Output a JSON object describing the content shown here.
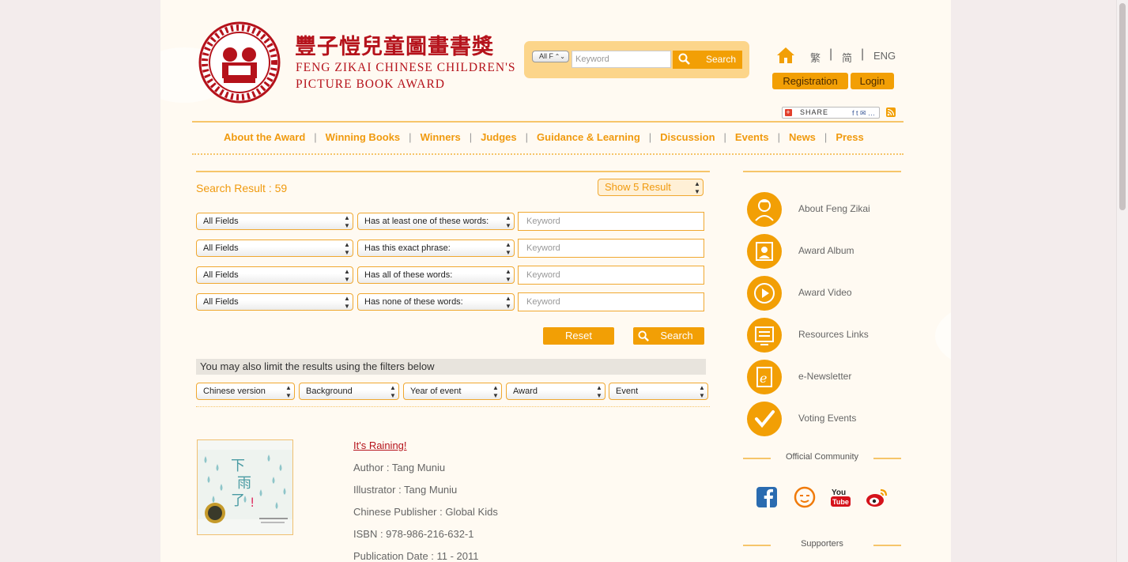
{
  "header": {
    "logo_zh": "豐子愷兒童圖畫書獎",
    "logo_en_line1": "FENG ZIKAI CHINESE CHILDREN'S",
    "logo_en_line2": "PICTURE BOOK AWARD"
  },
  "top_search": {
    "scope": "All F",
    "placeholder": "Keyword",
    "button": "Search"
  },
  "languages": [
    "繁",
    "简",
    "ENG"
  ],
  "account": {
    "register": "Registration",
    "login": "Login"
  },
  "share": {
    "label": "SHARE",
    "icons": "f t ✉ …"
  },
  "nav": [
    "About the Award",
    "Winning Books",
    "Winners",
    "Judges",
    "Guidance & Learning",
    "Discussion",
    "Events",
    "News",
    "Press"
  ],
  "search": {
    "result_label": "Search Result : 59",
    "show_option": "Show 5 Result",
    "rows": [
      {
        "field": "All Fields",
        "mode": "Has at least one of these words:",
        "placeholder": "Keyword"
      },
      {
        "field": "All Fields",
        "mode": "Has this exact phrase:",
        "placeholder": "Keyword"
      },
      {
        "field": "All Fields",
        "mode": "Has all of these words:",
        "placeholder": "Keyword"
      },
      {
        "field": "All Fields",
        "mode": "Has none of these words:",
        "placeholder": "Keyword"
      }
    ],
    "reset": "Reset",
    "search": "Search",
    "limit_text": "You may also limit the results using the filters below",
    "filters": [
      "Chinese version",
      "Background",
      "Year of event",
      "Award",
      "Event"
    ]
  },
  "book": {
    "title": "It's Raining!",
    "author": "Author : Tang Muniu",
    "illustrator": "Illustrator : Tang Muniu",
    "publisher": "Chinese Publisher : Global Kids",
    "isbn": "ISBN : 978-986-216-632-1",
    "date": "Publication Date : 11 - 2011",
    "cover_text": "下雨了"
  },
  "sidebar": {
    "items": [
      {
        "label": "About Feng Zikai",
        "icon": "portrait-icon"
      },
      {
        "label": "Award Album",
        "icon": "album-icon"
      },
      {
        "label": "Award Video",
        "icon": "play-icon"
      },
      {
        "label": "Resources Links",
        "icon": "links-icon"
      },
      {
        "label": "e-Newsletter",
        "icon": "newsletter-icon"
      },
      {
        "label": "Voting Events",
        "icon": "check-icon"
      }
    ],
    "community": "Official Community",
    "supporters": "Supporters",
    "social": [
      "facebook-icon",
      "douban-icon",
      "youtube-icon",
      "weibo-icon"
    ]
  },
  "colors": {
    "accent": "#f29f05",
    "brand_red": "#b5121b",
    "nav_text": "#f09a0e",
    "page_bg": "#fffaf2"
  }
}
